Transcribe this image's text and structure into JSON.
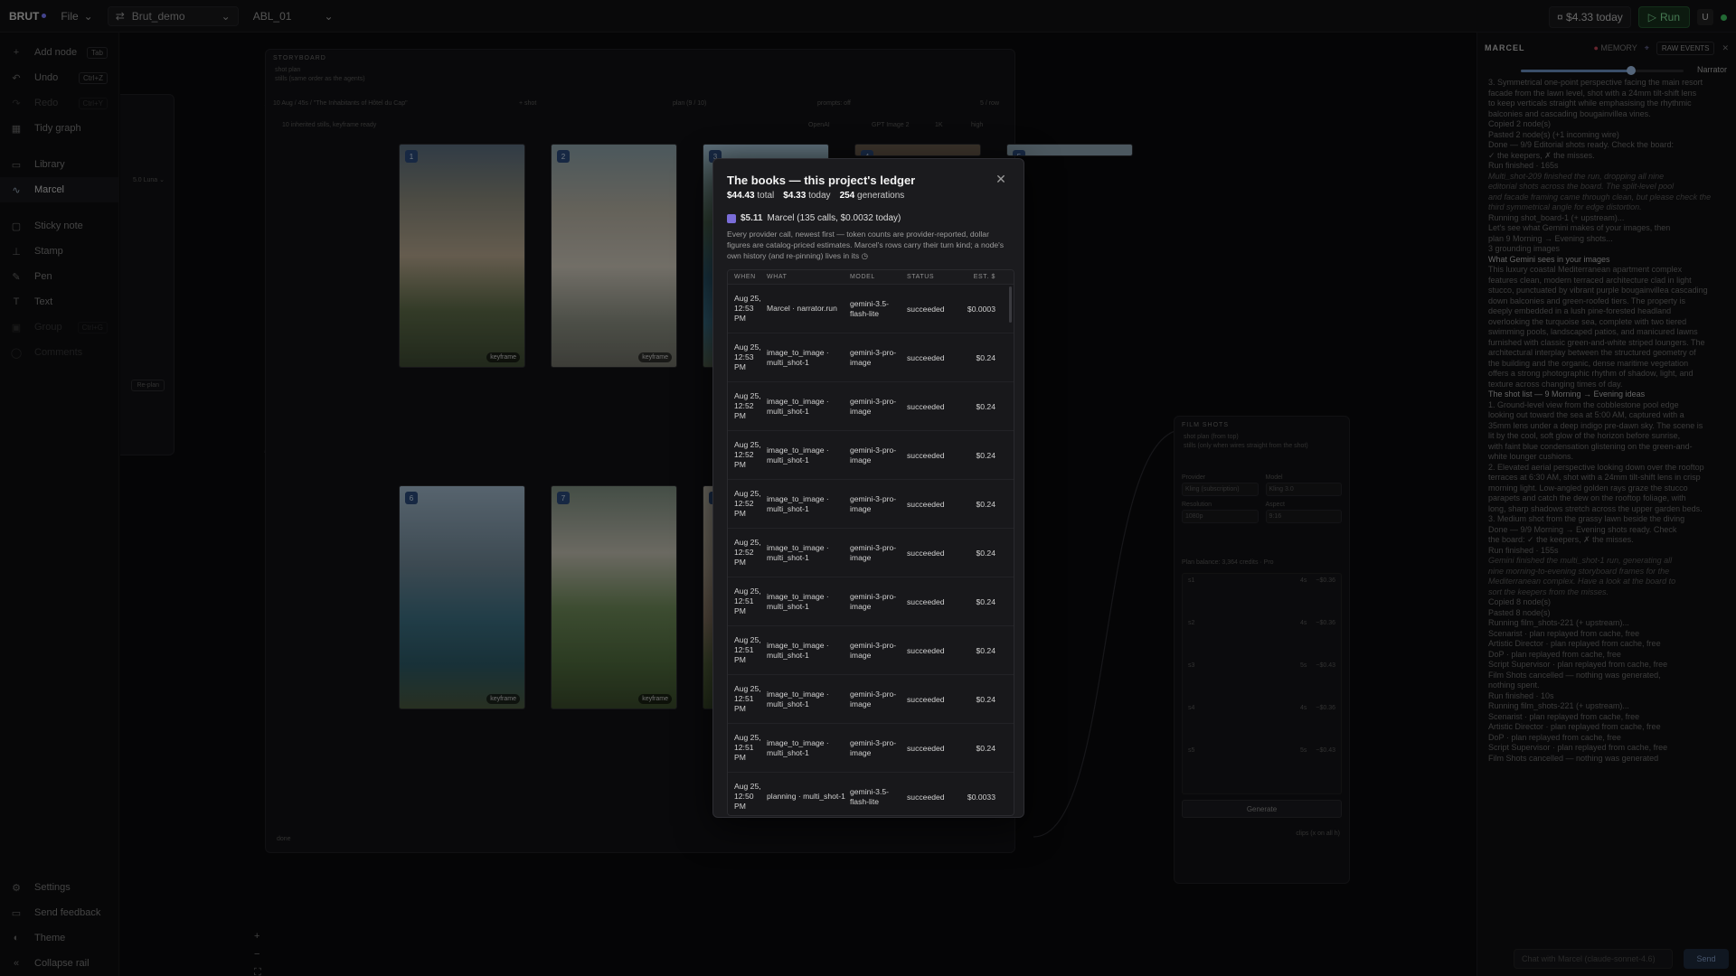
{
  "topbar": {
    "brand": "BRUT",
    "file_label": "File",
    "project": "Brut_demo",
    "branch": "ABL_01",
    "cost": "$4.33 today",
    "run_label": "Run",
    "user_initial": "U"
  },
  "sidebar": {
    "items": [
      {
        "label": "Add node",
        "kbd": "Tab",
        "icon": "plus-icon"
      },
      {
        "label": "Undo",
        "kbd": "Ctrl+Z",
        "icon": "undo-icon"
      },
      {
        "label": "Redo",
        "kbd": "Ctrl+Y",
        "icon": "redo-icon"
      },
      {
        "label": "Tidy graph",
        "kbd": "",
        "icon": "grid-icon"
      },
      {
        "label": "Library",
        "kbd": "",
        "icon": "library-icon"
      },
      {
        "label": "Marcel",
        "kbd": "",
        "icon": "pulse-icon"
      },
      {
        "label": "Sticky note",
        "kbd": "",
        "icon": "note-icon"
      },
      {
        "label": "Stamp",
        "kbd": "",
        "icon": "stamp-icon"
      },
      {
        "label": "Pen",
        "kbd": "",
        "icon": "pen-icon"
      },
      {
        "label": "Text",
        "kbd": "",
        "icon": "text-icon"
      },
      {
        "label": "Group",
        "kbd": "Ctrl+G",
        "icon": "group-icon"
      },
      {
        "label": "Comments",
        "kbd": "",
        "icon": "comment-icon"
      }
    ],
    "bottom": [
      {
        "label": "Settings",
        "icon": "gear-icon"
      },
      {
        "label": "Send feedback",
        "icon": "chat-icon"
      },
      {
        "label": "Theme",
        "icon": "theme-icon"
      },
      {
        "label": "Collapse rail",
        "icon": "collapse-icon"
      }
    ]
  },
  "storyboard": {
    "title": "STORYBOARD",
    "inputs": [
      "shot plan",
      "stills (same order as the agents)"
    ],
    "subtitle": "10 Aug / 45s / \"The Inhabitants of Hôtel du Cap\"",
    "note": "10 inherited stills, keyframe ready",
    "plan_label": "plan (9 / 10)",
    "prompts": "prompts: off",
    "per_row": "5 / row",
    "provider": "OpenAI",
    "model": "GPT Image 2",
    "res": "1K",
    "quality": "high",
    "keyframe": "keyframe",
    "done": "done",
    "frames": [
      "1",
      "2",
      "3",
      "4",
      "5",
      "6",
      "7",
      "8"
    ]
  },
  "ledger": {
    "title": "The books — this project's ledger",
    "total": "$44.43",
    "total_label": "total",
    "today": "$4.33",
    "today_label": "today",
    "generations": "254",
    "generations_label": "generations",
    "marcel_amount": "$5.11",
    "marcel_text": "Marcel (135 calls, $0.0032 today)",
    "description": "Every provider call, newest first — token counts are provider-reported, dollar figures are catalog-priced estimates. Marcel's rows carry their turn kind; a node's own history (and re-pinning) lives in its",
    "columns": [
      "WHEN",
      "WHAT",
      "MODEL",
      "STATUS",
      "EST. $"
    ],
    "rows": [
      {
        "when": "Aug 25, 12:53 PM",
        "what": "Marcel · narrator.run",
        "model": "gemini-3.5-flash-lite",
        "status": "succeeded",
        "cost": "$0.0003"
      },
      {
        "when": "Aug 25, 12:53 PM",
        "what": "image_to_image · multi_shot-1",
        "model": "gemini-3-pro-image",
        "status": "succeeded",
        "cost": "$0.24"
      },
      {
        "when": "Aug 25, 12:52 PM",
        "what": "image_to_image · multi_shot-1",
        "model": "gemini-3-pro-image",
        "status": "succeeded",
        "cost": "$0.24"
      },
      {
        "when": "Aug 25, 12:52 PM",
        "what": "image_to_image · multi_shot-1",
        "model": "gemini-3-pro-image",
        "status": "succeeded",
        "cost": "$0.24"
      },
      {
        "when": "Aug 25, 12:52 PM",
        "what": "image_to_image · multi_shot-1",
        "model": "gemini-3-pro-image",
        "status": "succeeded",
        "cost": "$0.24"
      },
      {
        "when": "Aug 25, 12:52 PM",
        "what": "image_to_image · multi_shot-1",
        "model": "gemini-3-pro-image",
        "status": "succeeded",
        "cost": "$0.24"
      },
      {
        "when": "Aug 25, 12:51 PM",
        "what": "image_to_image · multi_shot-1",
        "model": "gemini-3-pro-image",
        "status": "succeeded",
        "cost": "$0.24"
      },
      {
        "when": "Aug 25, 12:51 PM",
        "what": "image_to_image · multi_shot-1",
        "model": "gemini-3-pro-image",
        "status": "succeeded",
        "cost": "$0.24"
      },
      {
        "when": "Aug 25, 12:51 PM",
        "what": "image_to_image · multi_shot-1",
        "model": "gemini-3-pro-image",
        "status": "succeeded",
        "cost": "$0.24"
      },
      {
        "when": "Aug 25, 12:51 PM",
        "what": "image_to_image · multi_shot-1",
        "model": "gemini-3-pro-image",
        "status": "succeeded",
        "cost": "$0.24"
      },
      {
        "when": "Aug 25, 12:50 PM",
        "what": "planning · multi_shot-1",
        "model": "gemini-3.5-flash-lite",
        "status": "succeeded",
        "cost": "$0.0033"
      }
    ]
  },
  "film_shots": {
    "title": "FILM SHOTS",
    "inputs": [
      "shot plan (from top)",
      "stills (only when wires straight from the shot)"
    ],
    "provider_label": "Provider",
    "provider": "Kling (subscription)",
    "model_label": "Model",
    "model": "Kling 3.0",
    "resolution_label": "Resolution",
    "resolution": "1080p",
    "aspect_label": "Aspect",
    "aspect": "9:16",
    "plan_balance": "Plan balance: 3,364 credits · Pro",
    "shots": [
      {
        "id": "s1",
        "dur": "4s",
        "cost": "~$0.36"
      },
      {
        "id": "s2",
        "dur": "4s",
        "cost": "~$0.36"
      },
      {
        "id": "s3",
        "dur": "5s",
        "cost": "~$0.43"
      },
      {
        "id": "s4",
        "dur": "4s",
        "cost": "~$0.36"
      },
      {
        "id": "s5",
        "dur": "5s",
        "cost": "~$0.43"
      }
    ],
    "generate_label": "Generate",
    "footer": "clips (x on all h)"
  },
  "chat": {
    "title": "MARCEL",
    "memory": "MEMORY",
    "raw_events": "RAW EVENTS",
    "slider_label": "Narrator",
    "messages": [
      "3. Symmetrical one-point perspective facing the main resort",
      "facade from the lawn level, shot with a 24mm tilt-shift lens",
      "to keep verticals straight while emphasising the rhythmic",
      "balconies and cascading bougainvillea vines.",
      "Copied 2 node(s)",
      "Pasted 2 node(s) (+1 incoming wire)",
      "Done — 9/9 Editorial shots ready. Check the board:",
      "✓ the keepers, ✗ the misses.",
      "Run finished · 165s",
      "Multi_shot-209 finished the run, dropping all nine",
      "editorial shots across the board. The split-level pool",
      "and facade framing came through clean, but please check the",
      "third symmetrical angle for edge distortion.",
      "Running shot_board-1 (+ upstream)...",
      "Let's see what Gemini makes of your images, then",
      "plan 9 Morning → Evening shots...",
      "3 grounding images",
      "What Gemini sees in your images",
      "This luxury coastal Mediterranean apartment complex",
      "features clean, modern terraced architecture clad in light",
      "stucco, punctuated by vibrant purple bougainvillea cascading",
      "down balconies and green-roofed tiers. The property is",
      "deeply embedded in a lush pine-forested headland",
      "overlooking the turquoise sea, complete with two tiered",
      "swimming pools, landscaped patios, and manicured lawns",
      "furnished with classic green-and-white striped loungers. The",
      "architectural interplay between the structured geometry of",
      "the building and the organic, dense maritime vegetation",
      "offers a strong photographic rhythm of shadow, light, and",
      "texture across changing times of day.",
      "The shot list — 9 Morning → Evening ideas",
      "1. Ground-level view from the cobblestone pool edge",
      "looking out toward the sea at 5:00 AM, captured with a",
      "35mm lens under a deep indigo pre-dawn sky. The scene is",
      "lit by the cool, soft glow of the horizon before sunrise,",
      "with faint blue condensation glistening on the green-and-",
      "white lounger cushions.",
      "2. Elevated aerial perspective looking down over the rooftop",
      "terraces at 6:30 AM, shot with a 24mm tilt-shift lens in crisp",
      "morning light. Low-angled golden rays graze the stucco",
      "parapets and catch the dew on the rooftop foliage, with",
      "long, sharp shadows stretch across the upper garden beds.",
      "3. Medium shot from the grassy lawn beside the diving",
      "Done — 9/9 Morning → Evening shots ready. Check",
      "the board: ✓ the keepers, ✗ the misses.",
      "Run finished · 155s",
      "Gemini finished the multi_shot-1 run, generating all",
      "nine morning-to-evening storyboard frames for the",
      "Mediterranean complex. Have a look at the board to",
      "sort the keepers from the misses.",
      "Copied 8 node(s)",
      "Pasted 8 node(s)",
      "Running film_shots-221 (+ upstream)...",
      "Scenarist · plan replayed from cache, free",
      "Artistic Director · plan replayed from cache, free",
      "DoP · plan replayed from cache, free",
      "Script Supervisor · plan replayed from cache, free",
      "Film Shots cancelled — nothing was generated,",
      "nothing spent.",
      "Run finished · 10s",
      "Running film_shots-221 (+ upstream)...",
      "Scenarist · plan replayed from cache, free",
      "Artistic Director · plan replayed from cache, free",
      "DoP · plan replayed from cache, free",
      "Script Supervisor · plan replayed from cache, free",
      "Film Shots cancelled — nothing was generated"
    ],
    "input_placeholder": "Chat with Marcel (claude-sonnet-4.6)",
    "send_label": "Send"
  }
}
